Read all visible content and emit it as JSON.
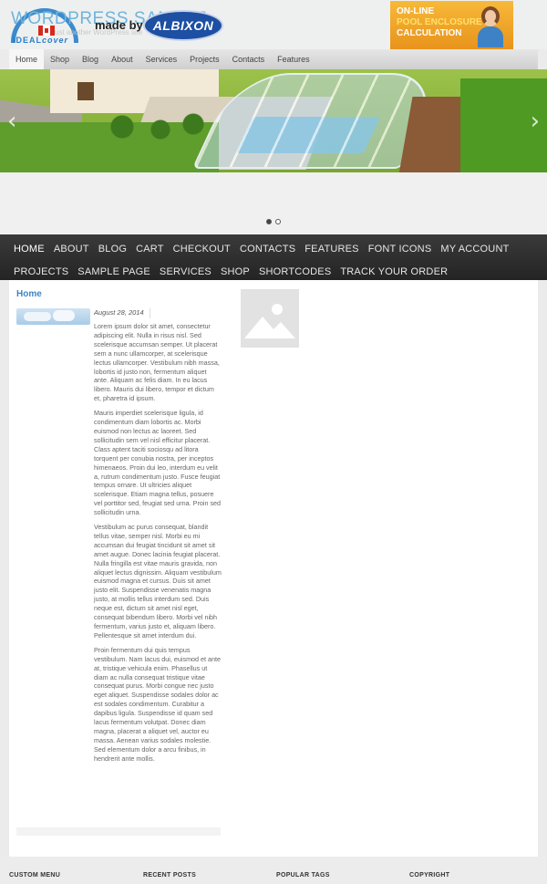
{
  "header": {
    "site_title": "WORDPRESS SAMPLE",
    "tagline": "Just another WordPress site",
    "logo": {
      "word1": "IDEAL",
      "word2": "cover"
    },
    "made_by": "made by",
    "partner_logo": "ALBIXON",
    "promo": {
      "line1": "ON-LINE",
      "line2": "POOL ENCLOSURE",
      "line3": "CALCULATION"
    }
  },
  "top_nav": [
    {
      "label": "Home",
      "active": true
    },
    {
      "label": "Shop"
    },
    {
      "label": "Blog"
    },
    {
      "label": "About"
    },
    {
      "label": "Services"
    },
    {
      "label": "Projects"
    },
    {
      "label": "Contacts"
    },
    {
      "label": "Features"
    }
  ],
  "slider": {
    "prev_icon": "chevron-left-icon",
    "next_icon": "chevron-right-icon",
    "slides": 2,
    "active_slide": 1
  },
  "main_nav": [
    {
      "label": "HOME",
      "active": true
    },
    {
      "label": "ABOUT"
    },
    {
      "label": "BLOG"
    },
    {
      "label": "CART"
    },
    {
      "label": "CHECKOUT"
    },
    {
      "label": "CONTACTS"
    },
    {
      "label": "FEATURES"
    },
    {
      "label": "FONT ICONS"
    },
    {
      "label": "MY ACCOUNT"
    },
    {
      "label": "PROJECTS"
    },
    {
      "label": "SAMPLE PAGE"
    },
    {
      "label": "SERVICES"
    },
    {
      "label": "SHOP"
    },
    {
      "label": "SHORTCODES"
    },
    {
      "label": "TRACK YOUR ORDER"
    }
  ],
  "content": {
    "heading": "Home",
    "post": {
      "date": "August 28, 2014",
      "paragraphs": [
        "Lorem ipsum dolor sit amet, consectetur adipiscing elit. Nulla in risus nisl. Sed scelerisque accumsan semper. Ut placerat sem a nunc ullamcorper, at scelerisque lectus ullamcorper. Vestibulum nibh massa, lobortis id justo non, fermentum aliquet ante. Aliquam ac felis diam. In eu lacus libero. Mauris dui libero, tempor et dictum et, pharetra id ipsum.",
        "Mauris imperdiet scelerisque ligula, id condimentum diam lobortis ac. Morbi euismod non lectus ac laoreet. Sed sollicitudin sem vel nisl efficitur placerat. Class aptent taciti sociosqu ad litora torquent per conubia nostra, per inceptos himenaeos. Proin dui leo, interdum eu velit a, rutrum condimentum justo. Fusce feugiat tempus ornare. Ut ultricies aliquet scelerisque. Etiam magna tellus, posuere vel porttitor sed, feugiat sed urna. Proin sed sollicitudin urna.",
        "Vestibulum ac purus consequat, blandit tellus vitae, semper nisl. Morbi eu mi accumsan dui feugiat tincidunt sit amet sit amet augue. Donec lacinia feugiat placerat. Nulla fringilla est vitae mauris gravida, non aliquet lectus dignissim. Aliquam vestibulum euismod magna et cursus. Duis sit amet justo elit. Suspendisse venenatis magna justo, at mollis tellus interdum sed. Duis neque est, dictum sit amet nisl eget, consequat bibendum libero. Morbi vel nibh fermentum, varius justo et, aliquam libero. Pellentesque sit amet interdum dui.",
        "Proin fermentum dui quis tempus vestibulum. Nam lacus dui, euismod et ante at, tristique vehicula enim. Phasellus ut diam ac nulla consequat tristique vitae consequat purus. Morbi congue nec justo eget aliquet. Suspendisse sodales dolor ac est sodales condimentum. Curabitur a dapibus ligula. Suspendisse id quam sed lacus fermentum volutpat. Donec diam magna, placerat a aliquet vel, auctor eu massa. Aenean varius sodales molestie. Sed elementum dolor a arcu finibus, in hendrerit ante mollis."
      ]
    },
    "placeholder_icon": "image-placeholder-icon"
  },
  "footer": {
    "columns": [
      "CUSTOM MENU",
      "RECENT POSTS",
      "POPULAR TAGS",
      "COPYRIGHT"
    ]
  },
  "colors": {
    "accent_blue": "#3d86c6",
    "nav_dark": "#2f2f2f",
    "promo_orange": "#f0a52a"
  }
}
